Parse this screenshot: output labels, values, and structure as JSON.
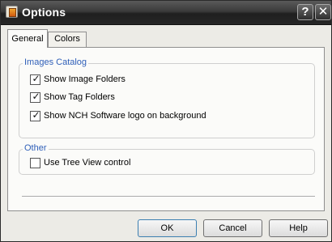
{
  "window": {
    "title": "Options",
    "help_glyph": "?",
    "close_glyph": "✕"
  },
  "tabs": [
    {
      "label": "General",
      "active": true
    },
    {
      "label": "Colors",
      "active": false
    }
  ],
  "images_catalog": {
    "title": "Images Catalog",
    "options": [
      {
        "label": "Show Image Folders",
        "checked": true
      },
      {
        "label": "Show Tag Folders",
        "checked": true
      },
      {
        "label": "Show NCH Software logo on background",
        "checked": true
      }
    ]
  },
  "other": {
    "title": "Other",
    "options": [
      {
        "label": "Use Tree View control",
        "checked": false
      }
    ]
  },
  "buttons": {
    "ok": "OK",
    "cancel": "Cancel",
    "help": "Help"
  },
  "check_glyph": "✓",
  "icons": {
    "app": "app-icon",
    "help": "help-icon",
    "close": "close-icon"
  },
  "colors": {
    "group_title": "#2f5fb8",
    "titlebar": "#2b2b2b",
    "dialog_bg": "#ecebe6"
  }
}
